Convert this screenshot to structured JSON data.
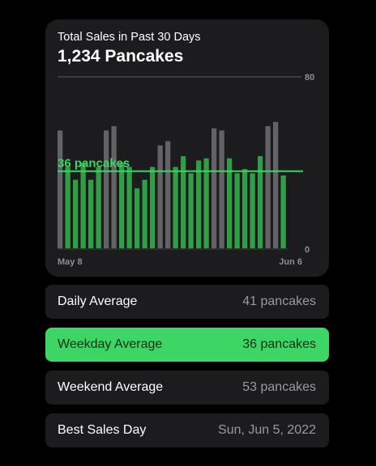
{
  "header": {
    "title": "Total Sales in Past 30 Days",
    "total": "1,234 Pancakes"
  },
  "colors": {
    "accent": "#3dd664",
    "weekday_bar": "#2f9e45",
    "weekend_bar": "#636366",
    "card_bg": "#1c1c1e",
    "secondary_text": "#9a9a9f"
  },
  "chart_data": {
    "type": "bar",
    "x_start_label": "May 8",
    "x_end_label": "Jun 6",
    "ylim": [
      0,
      80
    ],
    "y_tick_labels": [
      "80",
      "0"
    ],
    "rule_value": 36,
    "rule_label": "36 pancakes",
    "values": [
      55,
      38,
      32,
      40,
      32,
      38,
      55,
      57,
      40,
      38,
      28,
      32,
      38,
      48,
      50,
      38,
      43,
      35,
      41,
      42,
      56,
      55,
      42,
      35,
      37,
      35,
      43,
      57,
      59,
      34
    ],
    "weekend": [
      true,
      false,
      false,
      false,
      false,
      false,
      true,
      true,
      false,
      false,
      false,
      false,
      false,
      true,
      true,
      false,
      false,
      false,
      false,
      false,
      true,
      true,
      false,
      false,
      false,
      false,
      false,
      true,
      true,
      false
    ]
  },
  "stats": [
    {
      "label": "Daily Average",
      "value": "41 pancakes",
      "highlighted": false
    },
    {
      "label": "Weekday Average",
      "value": "36 pancakes",
      "highlighted": true
    },
    {
      "label": "Weekend Average",
      "value": "53 pancakes",
      "highlighted": false
    },
    {
      "label": "Best Sales Day",
      "value": "Sun, Jun 5, 2022",
      "highlighted": false
    }
  ]
}
